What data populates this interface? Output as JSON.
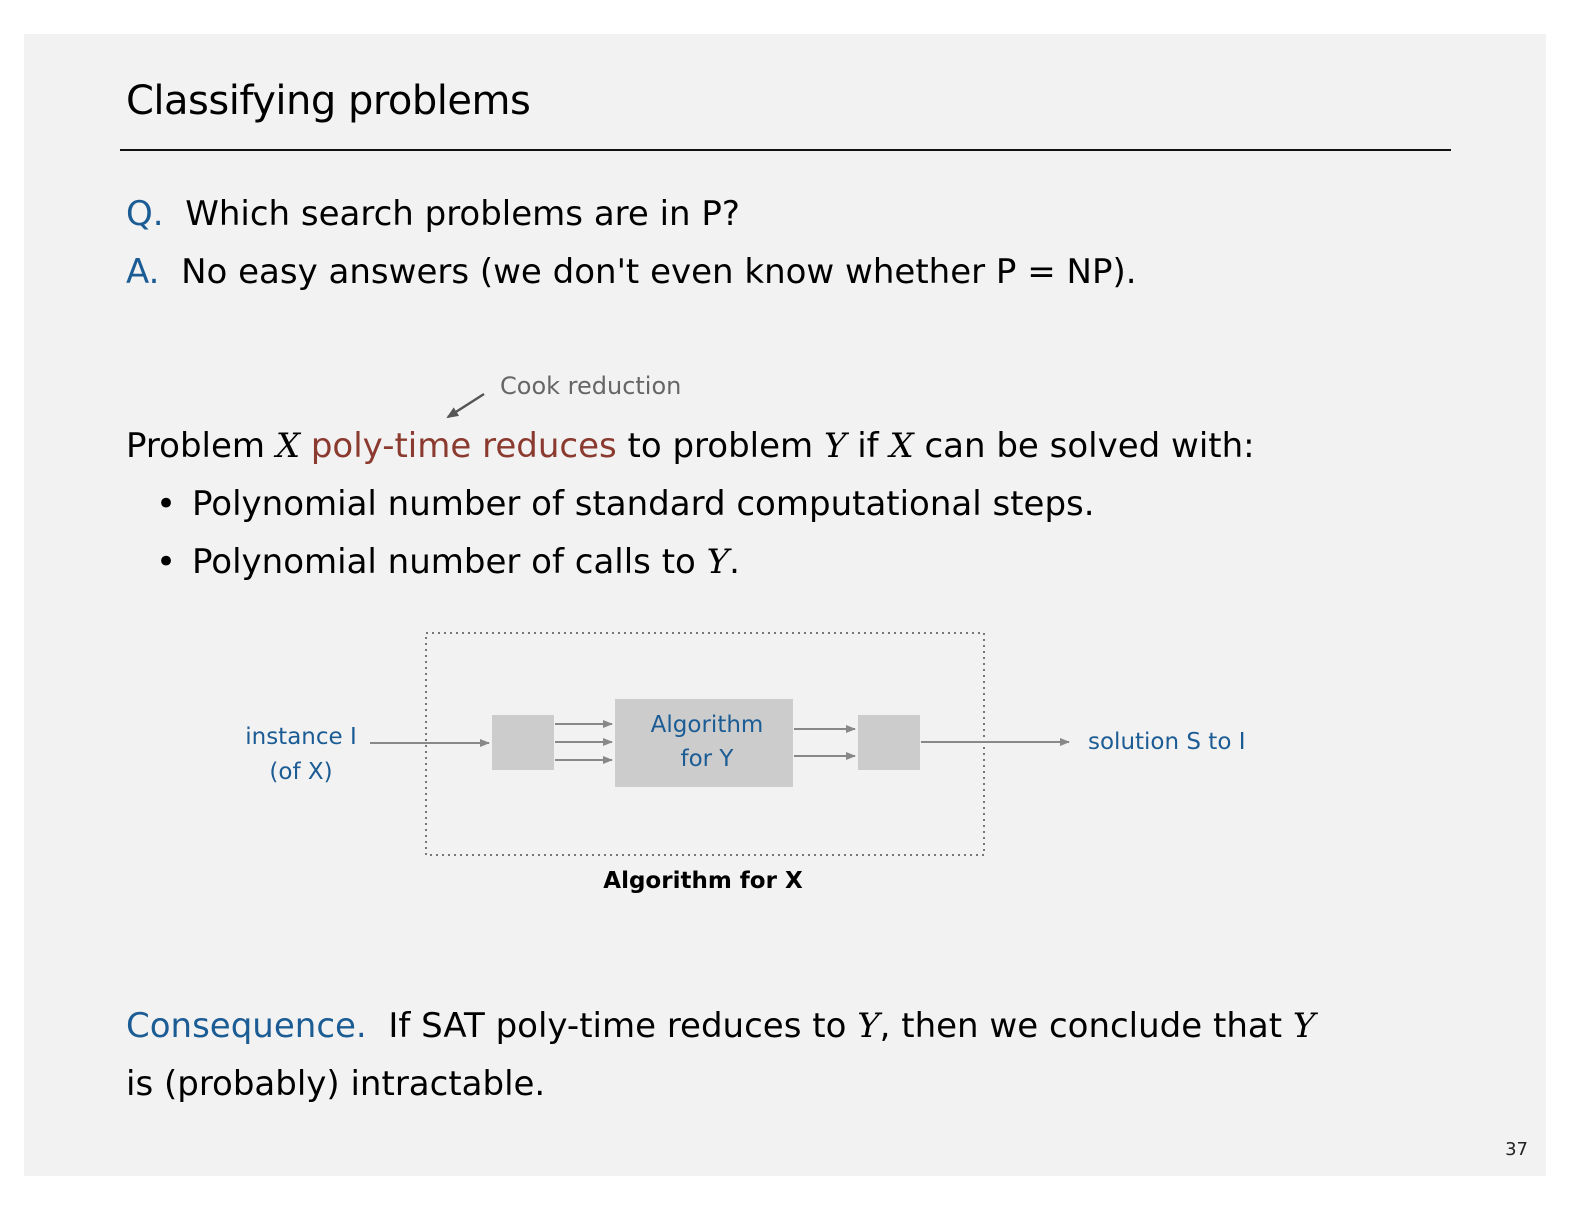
{
  "title": "Classifying problems",
  "qa": {
    "q_marker": "Q.",
    "q_text": "Which search problems are in P?",
    "a_marker": "A.",
    "a_text": "No easy answers (we don't even know whether P = NP)."
  },
  "annotation": "Cook reduction",
  "definition": {
    "p1": "Problem ",
    "x": "X",
    "term": "poly-time reduces",
    "p2": " to problem ",
    "y": "Y",
    "p3": " if ",
    "p4": " can be solved with:"
  },
  "bullets": {
    "b1": "Polynomial number of standard computational steps.",
    "b2_pre": "Polynomial number of calls to ",
    "b2_post": "."
  },
  "diagram": {
    "input_line1": "instance I",
    "input_line2": "(of X)",
    "inner_line1": "Algorithm",
    "inner_line2": "for Y",
    "output": "solution S to I",
    "caption": "Algorithm for X"
  },
  "consequence": {
    "label": "Consequence.",
    "text1": "  If SAT poly-time reduces to ",
    "text2": ", then we conclude that ",
    "text3": "is (probably) intractable."
  },
  "page_number": "37",
  "colors": {
    "accent_blue": "#1c5c94",
    "term_red": "#8b3a2f",
    "box_gray": "#cccccc",
    "background": "#f2f2f2"
  }
}
